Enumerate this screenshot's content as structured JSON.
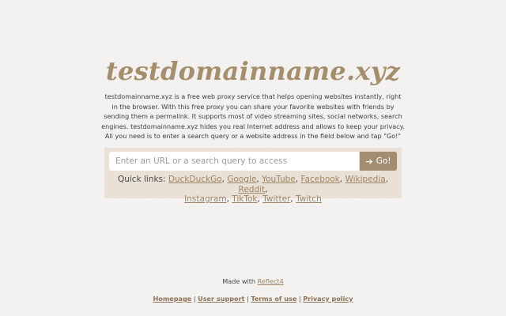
{
  "site": {
    "logo_text": "testdomainname.xyz",
    "intro": "testdomainname.xyz is a free web proxy service that helps opening websites instantly, right in the browser. With this free proxy you can share your favorite websites with friends by sending them a permalink. It supports most of video streaming sites, social networks, search engines. testdomainname.xyz hides you real Internet address and allows to keep your privacy. All you need is to enter a search query or a website address in the field below and tap \"Go!\""
  },
  "search": {
    "placeholder": "Enter an URL or a search query to access",
    "value": "",
    "button_icon": "arrow-right-icon",
    "button_arrow": "➔",
    "button_label": "Go!"
  },
  "quick_links": {
    "label": "Quick links:",
    "separator": ",",
    "items": [
      "DuckDuckGo",
      "Google",
      "YouTube",
      "Facebook",
      "Wikipedia",
      "Reddit",
      "Instagram",
      "TikTok",
      "Twitter",
      "Twitch"
    ]
  },
  "footer": {
    "made_with_text": "Made with",
    "made_with_link": "Reflect4",
    "separator": "|",
    "links": [
      "Homepage",
      "User support",
      "Terms of use",
      "Privacy policy"
    ]
  },
  "colors": {
    "logo": "#a58e6c",
    "panel_background": "#e9e1d5",
    "button": "#a28d70",
    "link": "#9d8464",
    "page_background": "#f4f3f1"
  }
}
